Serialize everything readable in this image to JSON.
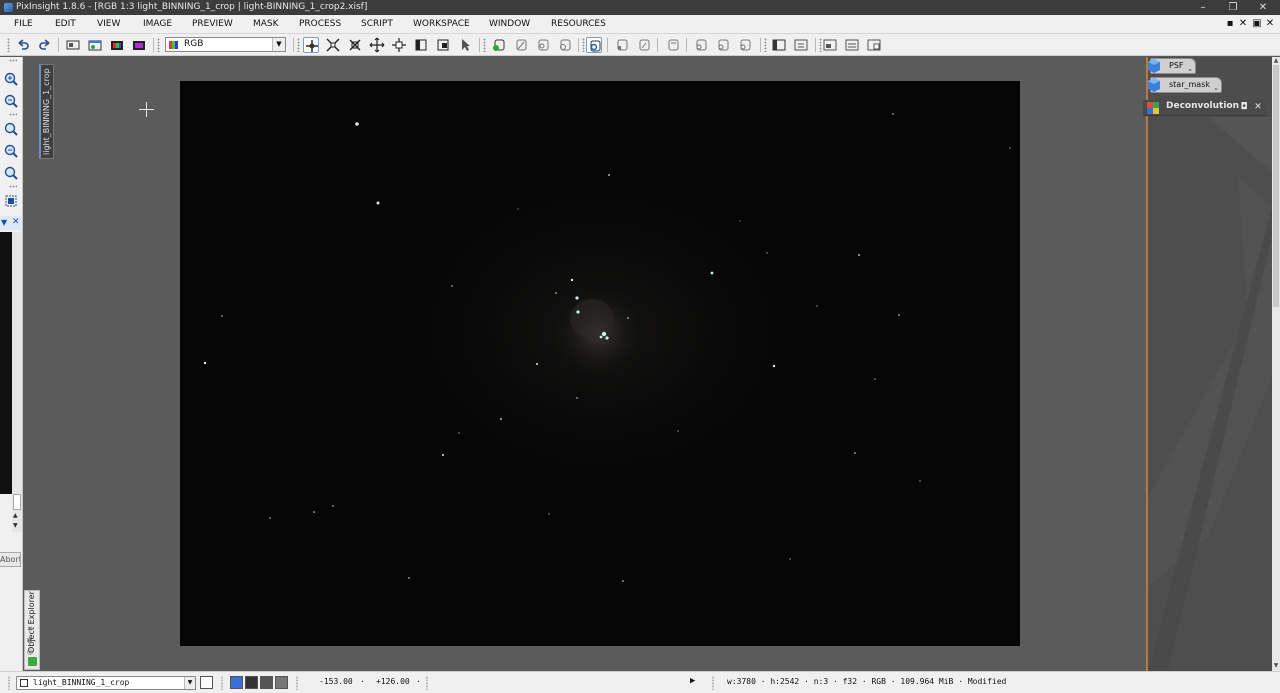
{
  "window": {
    "title": "PixInsight 1.8.6 - [RGB 1:3 light_BINNING_1_crop | light-BINNING_1_crop2.xisf]",
    "minimize": "–",
    "restore": "❐",
    "close": "✕"
  },
  "menubar": {
    "items": [
      "FILE",
      "EDIT",
      "VIEW",
      "IMAGE",
      "PREVIEW",
      "MASK",
      "PROCESS",
      "SCRIPT",
      "WORKSPACE",
      "WINDOW",
      "RESOURCES"
    ],
    "mdi_controls": [
      "▪",
      "✕",
      "▣",
      "✕"
    ]
  },
  "toolbar": {
    "channel_select": "RGB"
  },
  "left_panel": {
    "abort_label": "Abort"
  },
  "image_window": {
    "tab_label": "light_BINNING_1_crop"
  },
  "object_explorer": {
    "label": "Object Explorer"
  },
  "process_icons": [
    {
      "label": "PSF",
      "color": "#3d7fd9"
    },
    {
      "label": "star_mask",
      "color": "#3d7fd9"
    }
  ],
  "deconvolution": {
    "title": "Deconvolution",
    "float_btn": "◘",
    "close_btn": "✕"
  },
  "statusbar": {
    "view_name": "light_BINNING_1_crop",
    "cursor_x": "-153.00",
    "cursor_y": "+126.00",
    "info": "w:3780 · h:2542 · n:3 · f32 · RGB · 109.964 MiB · Modified",
    "play": "▶"
  }
}
